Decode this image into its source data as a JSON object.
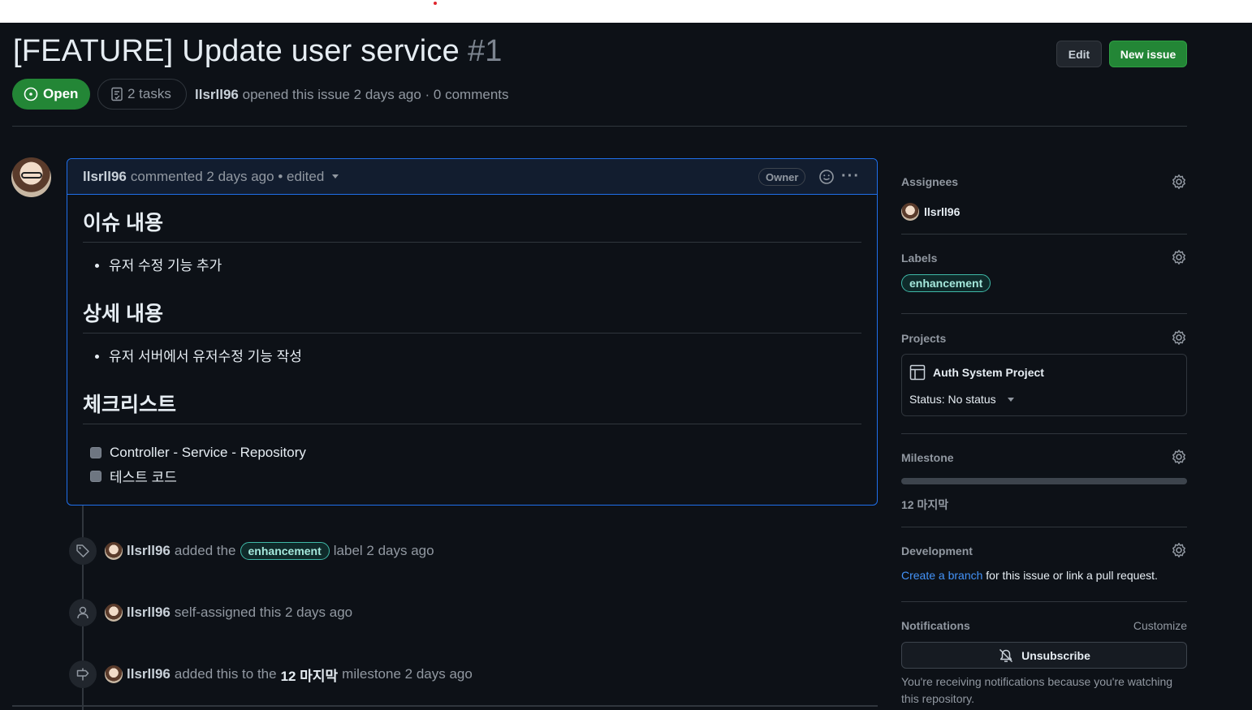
{
  "issue": {
    "title": "[FEATURE] Update user service",
    "number": "#1",
    "state": "Open",
    "tasks": "2 tasks",
    "author": "llsrll96",
    "meta_text": "opened this issue 2 days ago · 0 comments"
  },
  "header": {
    "edit_label": "Edit",
    "new_issue_label": "New issue"
  },
  "comment": {
    "author": "llsrll96",
    "meta": "commented 2 days ago • edited",
    "role_badge": "Owner",
    "sections": [
      {
        "heading": "이슈 내용",
        "bullet": "유저 수정 기능 추가"
      },
      {
        "heading": "상세 내용",
        "bullet": "유저 서버에서 유저수정 기능 작성"
      },
      {
        "heading": "체크리스트"
      }
    ],
    "checklist": [
      "Controller - Service - Repository",
      "테스트 코드"
    ]
  },
  "timeline": [
    {
      "icon": "tag-icon",
      "user": "llsrll96",
      "pre": "added the",
      "label": "enhancement",
      "post": "label 2 days ago"
    },
    {
      "icon": "person-icon",
      "user": "llsrll96",
      "text": "self-assigned this 2 days ago"
    },
    {
      "icon": "milestone-icon",
      "user": "llsrll96",
      "pre": "added this to the",
      "milestone": "12 마지막",
      "post": "milestone 2 days ago"
    }
  ],
  "sidebar": {
    "assignees": {
      "title": "Assignees",
      "user": "llsrll96"
    },
    "labels": {
      "title": "Labels",
      "label": "enhancement"
    },
    "projects": {
      "title": "Projects",
      "project_name": "Auth System Project",
      "status": "Status: No status"
    },
    "milestone": {
      "title": "Milestone",
      "name": "12 마지막",
      "progress": 0
    },
    "development": {
      "title": "Development",
      "link1": "Create a branch",
      "rest": "for this issue or link a pull request."
    },
    "notifications": {
      "title": "Notifications",
      "customize": "Customize",
      "button": "Unsubscribe",
      "text": "You're receiving notifications because you're watching this repository."
    }
  },
  "colors": {
    "open_green": "#238636",
    "link_blue": "#4493f8",
    "label_teal": "#3fb9a8",
    "background": "#0d1117"
  }
}
